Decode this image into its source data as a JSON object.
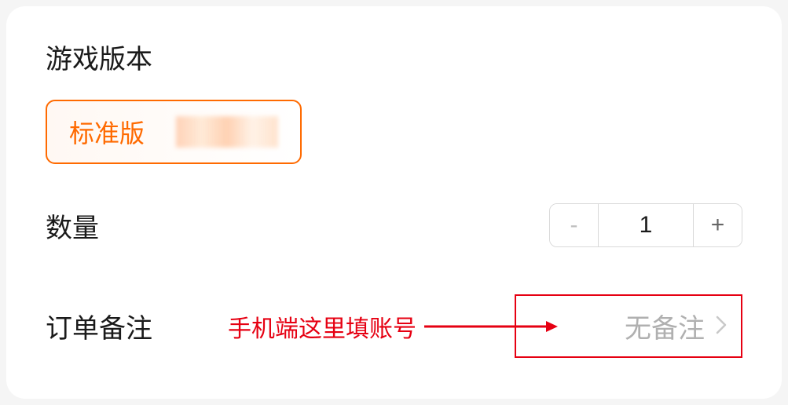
{
  "sections": {
    "version": {
      "label": "游戏版本",
      "selected": "标准版"
    },
    "quantity": {
      "label": "数量",
      "value": "1",
      "minus": "-",
      "plus": "+"
    },
    "remark": {
      "label": "订单备注",
      "placeholder": "无备注"
    }
  },
  "annotation": {
    "text": "手机端这里填账号"
  }
}
